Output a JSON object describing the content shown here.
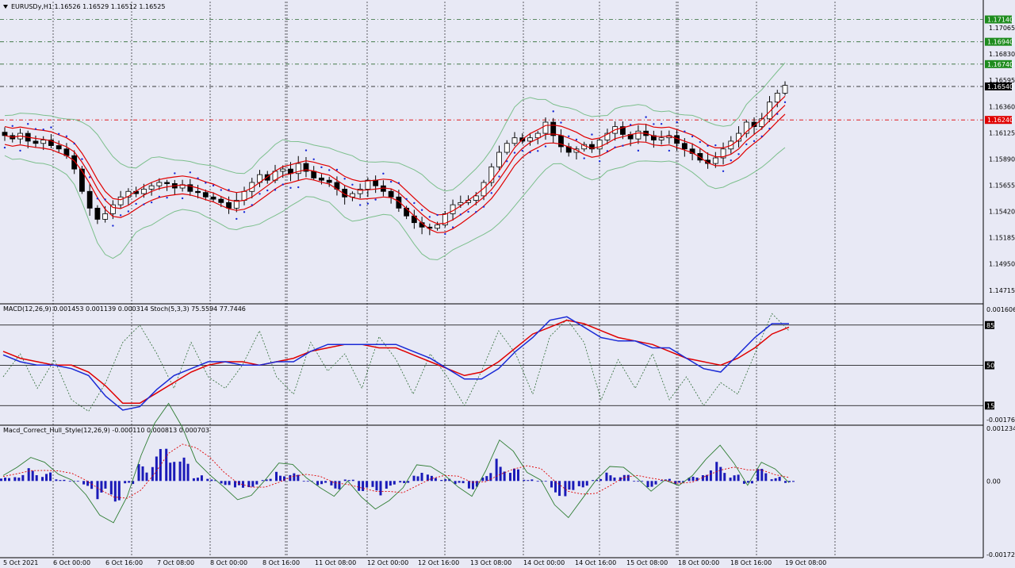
{
  "header": {
    "symbol_line": "EURUSDy,H1  1.16526 1.16529 1.16512 1.16525",
    "menu_icon": "triangle-down-icon"
  },
  "colors": {
    "background": "#e8e9f5",
    "grid": "#000000",
    "up_candle": "#ffffff",
    "down_candle": "#000000",
    "bollinger": "#7cbf8c",
    "envelope": "#e00000",
    "psar": "#1a2ad6",
    "macd_main": "#1a2ad6",
    "macd_signal": "#e00000",
    "stoch": "#2e6b35",
    "histogram": "#1a1ab8",
    "hull_fast": "#2e7d32",
    "hull_slow": "#e00000",
    "level_green_bg": "#1e8c1e",
    "level_red_bg": "#e00000",
    "level_black_bg": "#000000"
  },
  "chart_data": [
    {
      "type": "candlestick",
      "title": "EURUSDy,H1",
      "ohlc_last": {
        "open": 1.16526,
        "high": 1.16529,
        "low": 1.16512,
        "close": 1.16525
      },
      "y_ticks": [
        "1.17065",
        "1.16830",
        "1.16595",
        "1.16360",
        "1.16125",
        "1.15890",
        "1.15655",
        "1.15420",
        "1.15185",
        "1.14950",
        "1.14715"
      ],
      "ylim": [
        1.146,
        1.173
      ],
      "levels": [
        {
          "label": "1.17140",
          "value": 1.1714,
          "color": "green"
        },
        {
          "label": "1.16940",
          "value": 1.1694,
          "color": "green"
        },
        {
          "label": "1.16740",
          "value": 1.1674,
          "color": "green"
        },
        {
          "label": "1.16540",
          "value": 1.1654,
          "color": "black"
        },
        {
          "label": "1.16240",
          "value": 1.1624,
          "color": "red"
        }
      ],
      "close_path": [
        1.161,
        1.1607,
        1.1612,
        1.1605,
        1.1603,
        1.1606,
        1.1601,
        1.1598,
        1.1592,
        1.158,
        1.156,
        1.1545,
        1.1535,
        1.154,
        1.1548,
        1.1555,
        1.156,
        1.1558,
        1.1562,
        1.1565,
        1.1568,
        1.1567,
        1.1563,
        1.1566,
        1.156,
        1.1559,
        1.1555,
        1.1553,
        1.155,
        1.1545,
        1.1552,
        1.156,
        1.1568,
        1.1575,
        1.157,
        1.1578,
        1.158,
        1.1576,
        1.1585,
        1.1578,
        1.1572,
        1.157,
        1.1568,
        1.1562,
        1.1555,
        1.1558,
        1.1562,
        1.157,
        1.1565,
        1.156,
        1.1555,
        1.1545,
        1.1538,
        1.1532,
        1.1528,
        1.1527,
        1.153,
        1.154,
        1.1548,
        1.155,
        1.1552,
        1.1556,
        1.1568,
        1.1582,
        1.1595,
        1.1603,
        1.1608,
        1.1605,
        1.1608,
        1.1612,
        1.1622,
        1.161,
        1.16,
        1.1595,
        1.1598,
        1.1602,
        1.1598,
        1.1606,
        1.1612,
        1.1618,
        1.1611,
        1.1607,
        1.1614,
        1.161,
        1.1606,
        1.1608,
        1.161,
        1.1603,
        1.1598,
        1.1594,
        1.1588,
        1.1585,
        1.159,
        1.1598,
        1.1605,
        1.1612,
        1.1622,
        1.1618,
        1.1625,
        1.164,
        1.1648,
        1.1655
      ]
    },
    {
      "type": "line",
      "title": "MACD(12,26,9) 0.001453 0.001139 0.000314  Stoch(5,3,3) 75.5594 77.7446",
      "y_ticks": [
        "0.001606",
        "85",
        "50",
        "15",
        "-0.001768"
      ],
      "ylim": [
        -0.001768,
        0.001606
      ],
      "series": [
        {
          "name": "MACD",
          "values": [
            0.0002,
            0.0,
            -0.0001,
            -0.0001,
            -0.0002,
            -0.0004,
            -0.001,
            -0.0014,
            -0.0013,
            -0.0008,
            -0.0004,
            -0.0002,
            0.0,
            0.0,
            -0.0001,
            -0.0001,
            0.0,
            0.0,
            0.0003,
            0.0005,
            0.0005,
            0.0005,
            0.0005,
            0.0005,
            0.0003,
            0.0001,
            -0.0002,
            -0.0005,
            -0.0005,
            -0.0002,
            0.0003,
            0.0007,
            0.0012,
            0.0013,
            0.001,
            0.0007,
            0.0006,
            0.0006,
            0.0004,
            0.0004,
            0.0001,
            -0.0002,
            -0.0003,
            0.0002,
            0.0007,
            0.0011,
            0.0011
          ]
        },
        {
          "name": "Signal",
          "values": [
            0.0003,
            0.0001,
            0.0,
            -0.0001,
            -0.0001,
            -0.0003,
            -0.0007,
            -0.0012,
            -0.0012,
            -0.0009,
            -0.0006,
            -0.0003,
            -0.0001,
            0.0,
            0.0,
            -0.0001,
            0.0,
            0.0001,
            0.0003,
            0.0004,
            0.0005,
            0.0005,
            0.0004,
            0.0004,
            0.0002,
            0.0,
            -0.0002,
            -0.0004,
            -0.0003,
            0.0,
            0.0004,
            0.0008,
            0.001,
            0.0012,
            0.0011,
            0.0009,
            0.0007,
            0.0006,
            0.0005,
            0.0003,
            0.0001,
            0.0,
            -0.0001,
            0.0001,
            0.0004,
            0.0008,
            0.001
          ]
        },
        {
          "name": "Stoch",
          "values": [
            40,
            60,
            30,
            55,
            20,
            10,
            35,
            70,
            85,
            60,
            30,
            70,
            40,
            30,
            50,
            80,
            40,
            25,
            70,
            45,
            60,
            30,
            75,
            55,
            25,
            60,
            40,
            15,
            45,
            80,
            60,
            25,
            75,
            90,
            70,
            20,
            55,
            30,
            60,
            20,
            40,
            15,
            35,
            25,
            60,
            95,
            80
          ]
        }
      ]
    },
    {
      "type": "bar",
      "title": "Macd_Correct_Hull_Style(12,26,9) -0.000110 0.000813 0.000703",
      "y_ticks": [
        "0.001234",
        "0.00",
        "-0.001726"
      ],
      "ylim": [
        -0.001726,
        0.001234
      ],
      "series": [
        {
          "name": "Histogram",
          "values": [
            8e-05,
            0.00018,
            0.0003,
            0.0002,
            5e-05,
            0.0,
            -0.0002,
            -0.00045,
            -0.0005,
            -0.0001,
            0.0004,
            0.00075,
            0.00095,
            0.00055,
            0.00015,
            5e-05,
            -0.0001,
            -0.00025,
            -0.00015,
            5e-05,
            0.00025,
            0.00018,
            0.0,
            -0.0001,
            -0.0002,
            5e-05,
            -0.00025,
            -0.00035,
            -0.0002,
            -5e-05,
            0.00025,
            0.00015,
            5e-05,
            -0.0001,
            -0.0002,
            0.0002,
            0.00055,
            0.0003,
            5e-05,
            0.0,
            -0.00035,
            -0.00045,
            -0.00015,
            5e-05,
            0.0002,
            0.00015,
            0.0,
            -0.00015,
            5e-05,
            -8e-05,
            0.0001,
            0.0003,
            0.00045,
            0.00015,
            -0.0001,
            0.0003,
            0.0001,
            -5e-05
          ]
        }
      ],
      "x_ticks": [
        "5 Oct 2021",
        "6 Oct 00:00",
        "6 Oct 16:00",
        "7 Oct 08:00",
        "8 Oct 00:00",
        "8 Oct 16:00",
        "11 Oct 08:00",
        "12 Oct 00:00",
        "12 Oct 16:00",
        "13 Oct 08:00",
        "14 Oct 00:00",
        "14 Oct 16:00",
        "15 Oct 08:00",
        "18 Oct 00:00",
        "18 Oct 16:00",
        "19 Oct 08:00"
      ]
    }
  ]
}
